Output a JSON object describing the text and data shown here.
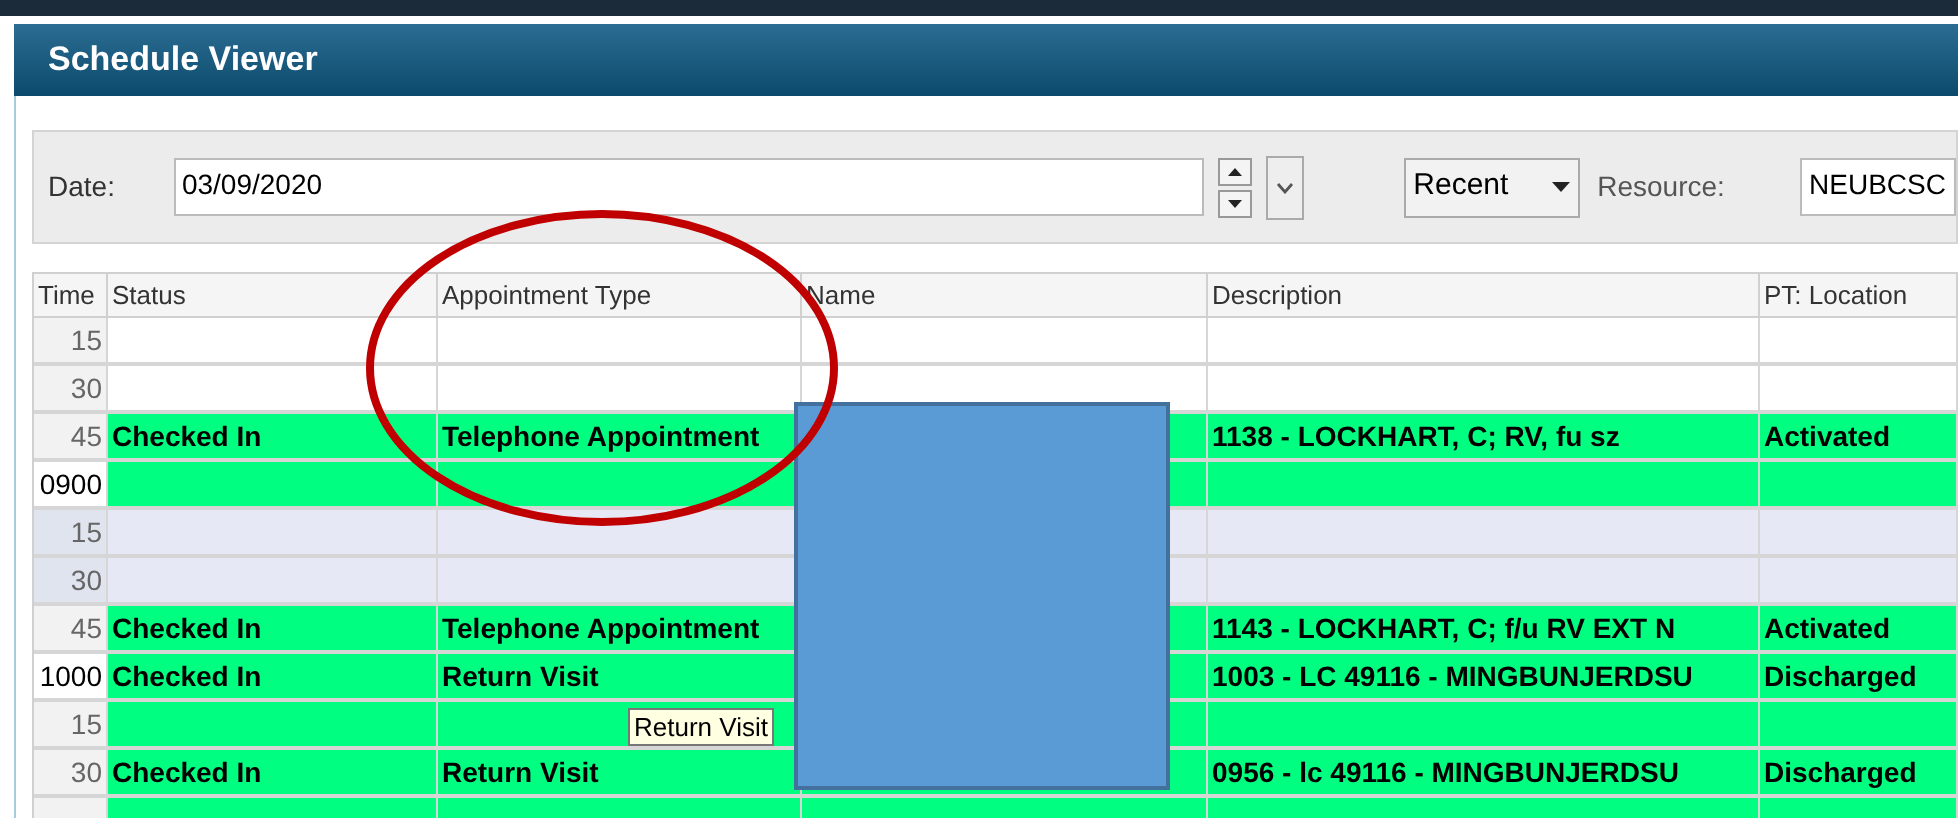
{
  "window": {
    "title": "Schedule Viewer"
  },
  "filters": {
    "date_label": "Date:",
    "date_value": "03/09/2020",
    "range": "Recent",
    "resource_label": "Resource:",
    "resource_value": "NEUBCSC"
  },
  "table": {
    "columns": [
      "Time",
      "Status",
      "Appointment Type",
      "Name",
      "Description",
      "PT: Location"
    ],
    "rows": [
      {
        "time": "15",
        "kind": "open",
        "hour": false,
        "status": "",
        "type": "",
        "description": "",
        "location": ""
      },
      {
        "time": "30",
        "kind": "open",
        "hour": false,
        "status": "",
        "type": "",
        "description": "",
        "location": ""
      },
      {
        "time": "45",
        "kind": "booked",
        "hour": false,
        "status": "Checked In",
        "type": "Telephone Appointment",
        "description": "1138 - LOCKHART, C; RV, fu sz",
        "location": "Activated"
      },
      {
        "time": "0900",
        "kind": "booked",
        "hour": true,
        "status": "",
        "type": "",
        "description": "",
        "location": ""
      },
      {
        "time": "15",
        "kind": "blocked",
        "hour": false,
        "status": "",
        "type": "",
        "description": "",
        "location": ""
      },
      {
        "time": "30",
        "kind": "blocked",
        "hour": false,
        "status": "",
        "type": "",
        "description": "",
        "location": ""
      },
      {
        "time": "45",
        "kind": "booked",
        "hour": false,
        "status": "Checked In",
        "type": "Telephone Appointment",
        "description": "1143 - LOCKHART, C; f/u RV EXT N",
        "location": "Activated"
      },
      {
        "time": "1000",
        "kind": "booked",
        "hour": true,
        "status": "Checked In",
        "type": "Return Visit",
        "description": "1003 - LC 49116 - MINGBUNJERDSU",
        "location": "Discharged"
      },
      {
        "time": "15",
        "kind": "booked",
        "hour": false,
        "status": "",
        "type": "",
        "description": "",
        "location": ""
      },
      {
        "time": "30",
        "kind": "booked",
        "hour": false,
        "status": "Checked In",
        "type": "Return Visit",
        "description": "0956 - lc 49116 - MINGBUNJERDSU",
        "location": "Discharged"
      },
      {
        "kind": "booked",
        "hour": false
      }
    ]
  },
  "tooltip": "Return Visit"
}
